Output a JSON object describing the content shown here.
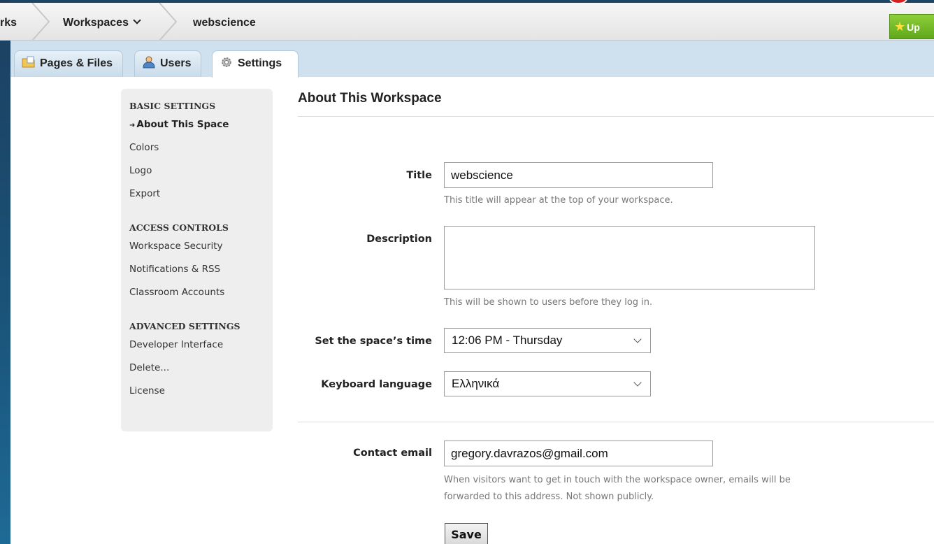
{
  "breadcrumb": {
    "first": "rks",
    "workspaces": "Workspaces",
    "current": "webscience"
  },
  "upgrade_label": "Up",
  "tabs": [
    {
      "label": "Pages & Files",
      "icon": "folder-icon"
    },
    {
      "label": "Users",
      "icon": "user-icon"
    },
    {
      "label": "Settings",
      "icon": "gear-icon",
      "active": true
    }
  ],
  "sidebar": {
    "basic_heading": "BASIC SETTINGS",
    "basic_items": [
      "About This Space",
      "Colors",
      "Logo",
      "Export"
    ],
    "access_heading": "ACCESS CONTROLS",
    "access_items": [
      "Workspace Security",
      "Notifications & RSS",
      "Classroom Accounts"
    ],
    "advanced_heading": "ADVANCED SETTINGS",
    "advanced_items": [
      "Developer Interface",
      "Delete...",
      "License"
    ],
    "current_marker": "➜"
  },
  "main": {
    "title": "About This Workspace",
    "title_field": {
      "label": "Title",
      "value": "webscience",
      "hint": "This title will appear at the top of your workspace."
    },
    "description_field": {
      "label": "Description",
      "value": "",
      "hint": "This will be shown to users before they log in."
    },
    "time_field": {
      "label": "Set the space’s time",
      "value": "12:06 PM - Thursday"
    },
    "keyboard_field": {
      "label": "Keyboard language",
      "value": "Ελληνικά"
    },
    "contact_field": {
      "label": "Contact email",
      "value": "gregory.davrazos@gmail.com",
      "hint_line1": "When visitors want to get in touch with the workspace owner, emails will be",
      "hint_line2": "forwarded to this address. Not shown publicly."
    },
    "save_label": "Save"
  },
  "colors": {
    "upgrade_green": "#6ab826",
    "tabbar_blue": "#cfe0ee",
    "sidebar_gray": "#eeeeee"
  }
}
